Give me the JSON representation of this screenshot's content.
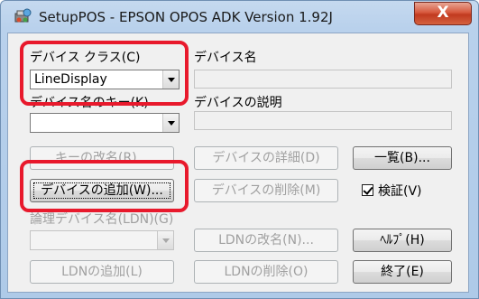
{
  "window": {
    "title": "SetupPOS - EPSON OPOS ADK Version 1.92J",
    "close_glyph": "X"
  },
  "device_class": {
    "label": "デバイス クラス(C)",
    "value": "LineDisplay"
  },
  "device_key": {
    "label": "デバイス名のキー(K)",
    "value": ""
  },
  "device_name": {
    "label": "デバイス名",
    "value": ""
  },
  "device_desc": {
    "label": "デバイスの説明",
    "value": ""
  },
  "ldn": {
    "label": "論理デバイス名(LDN)(G)",
    "value": ""
  },
  "buttons": {
    "rename_key": "キーの改名(R)...",
    "device_detail": "デバイスの詳細(D)",
    "list": "一覧(B)...",
    "add_device": "デバイスの追加(W)...",
    "delete_device": "デバイスの削除(M)",
    "rename_ldn": "LDNの改名(N)...",
    "help": "ﾍﾙﾌﾟ(H)",
    "add_ldn": "LDNの追加(L)",
    "delete_ldn": "LDNの削除(O)",
    "exit": "終了(E)"
  },
  "verify": {
    "label": "検証(V)",
    "checked": true
  },
  "colors": {
    "highlight": "#e8192c",
    "close_button": "#c13a1f"
  },
  "icons": {
    "app": "setup-pos-icon"
  }
}
